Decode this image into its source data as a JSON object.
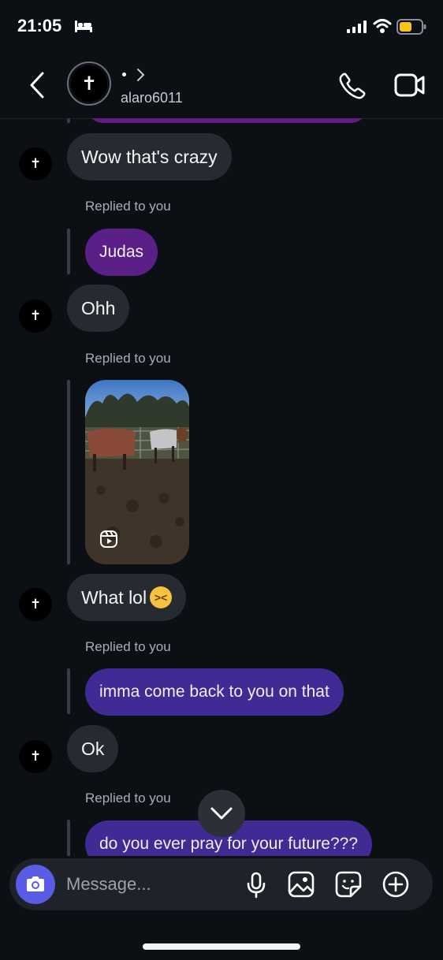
{
  "status_bar": {
    "time": "21:05"
  },
  "header": {
    "username": "alaro6011",
    "avatar_glyph": "✝"
  },
  "messages": [
    {
      "from": "them",
      "text": "Wow that's crazy"
    },
    {
      "from": "me",
      "replied_label": "Replied to you",
      "text": "Judas",
      "color": "#5b2088"
    },
    {
      "from": "them",
      "text": "Ohh"
    },
    {
      "from": "me",
      "replied_label": "Replied to you",
      "type": "reel"
    },
    {
      "from": "them",
      "text": "What lol",
      "emoji": "😆"
    },
    {
      "from": "me",
      "replied_label": "Replied to you",
      "text": "imma come back to you on that",
      "color": "#3f2b93"
    },
    {
      "from": "them",
      "text": "Ok"
    },
    {
      "from": "me",
      "replied_label": "Replied to you",
      "text": "do you ever pray for your future???",
      "color": "#3f2b93"
    }
  ],
  "composer": {
    "placeholder": "Message..."
  },
  "icons": {
    "back": "chevron-left-icon",
    "call": "phone-icon",
    "video": "video-camera-icon",
    "camera": "camera-icon",
    "mic": "microphone-icon",
    "gallery": "image-icon",
    "sticker": "sticker-icon",
    "plus": "plus-circle-icon",
    "scroll": "chevron-down-icon"
  },
  "colors": {
    "background": "#0c0f14",
    "incoming_bubble": "#262a31",
    "outgoing_purple": "#5b2088",
    "outgoing_indigo": "#3f2b93",
    "camera_button": "#5a5ce6"
  }
}
